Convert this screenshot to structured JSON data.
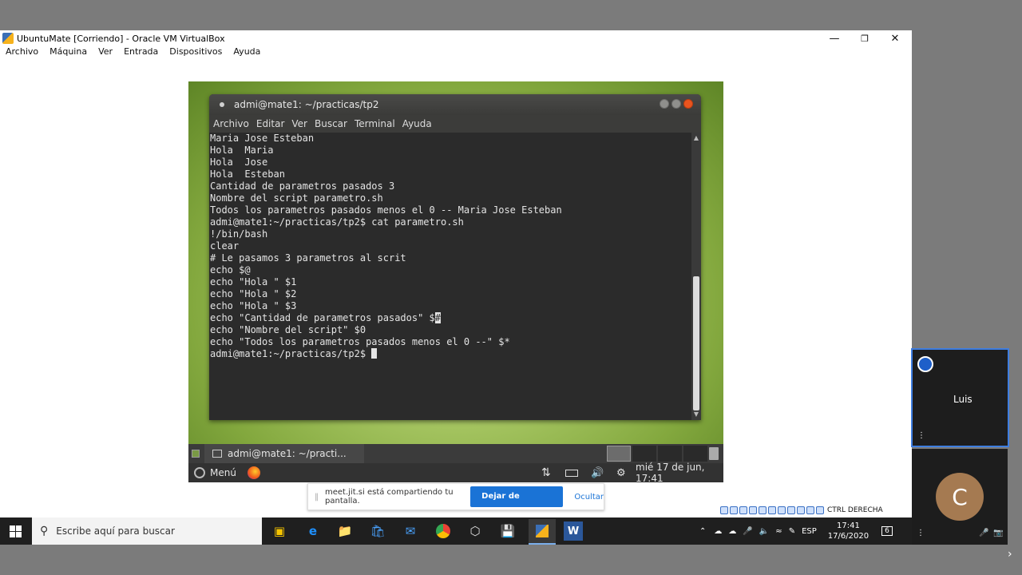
{
  "vbox": {
    "title": "UbuntuMate [Corriendo] - Oracle VM VirtualBox",
    "menu": [
      "Archivo",
      "Máquina",
      "Ver",
      "Entrada",
      "Dispositivos",
      "Ayuda"
    ],
    "status_label": "CTRL DERECHA"
  },
  "terminal": {
    "title": "admi@mate1: ~/practicas/tp2",
    "menu": [
      "Archivo",
      "Editar",
      "Ver",
      "Buscar",
      "Terminal",
      "Ayuda"
    ],
    "lines": [
      "Maria Jose Esteban",
      "Hola  Maria",
      "Hola  Jose",
      "Hola  Esteban",
      "Cantidad de parametros pasados 3",
      "Nombre del script parametro.sh",
      "Todos los parametros pasados menos el 0 -- Maria Jose Esteban",
      "admi@mate1:~/practicas/tp2$ cat parametro.sh",
      "!/bin/bash",
      "clear",
      "# Le pasamos 3 parametros al scrit",
      "echo $@",
      "echo \"Hola \" $1",
      "echo \"Hola \" $2",
      "echo \"Hola \" $3",
      "echo \"Cantidad de parametros pasados\" $",
      "echo \"Nombre del script\" $0",
      "echo \"Todos los parametros pasados menos el 0 --\" $*"
    ],
    "highlight_char": "#",
    "prompt": "admi@mate1:~/practicas/tp2$ "
  },
  "mate_panel": {
    "task_item": "admi@mate1: ~/practi...",
    "menu_label": "Menú",
    "clock": "mié 17 de jun, 17:41"
  },
  "share_bar": {
    "message": "meet.jit.si está compartiendo tu pantalla.",
    "stop_label": "Dejar de compartir",
    "hide_label": "Ocultar"
  },
  "windows_taskbar": {
    "search_placeholder": "Escribe aquí para buscar",
    "lang": "ESP",
    "time": "17:41",
    "date": "17/6/2020",
    "notifications": "6"
  },
  "jitsi": {
    "participant_name": "Luis",
    "avatar_letter": "C"
  }
}
